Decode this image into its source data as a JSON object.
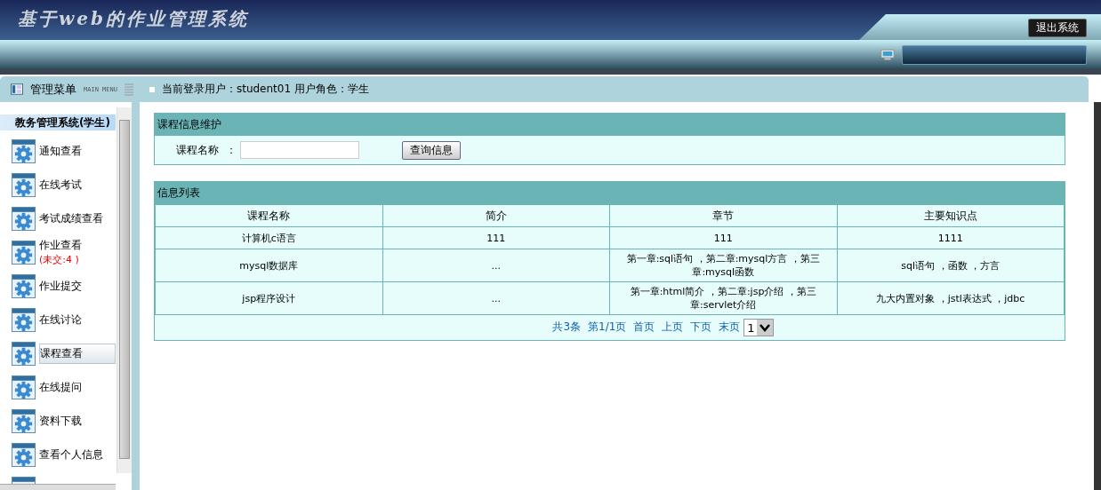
{
  "header": {
    "title": "基于web的作业管理系统",
    "logout_button": "退出系统"
  },
  "menu_bar": {
    "title": "管理菜单",
    "subtitle": "MAIN MENU",
    "user_info": "当前登录用户：student01  用户角色：学生"
  },
  "sidebar": {
    "heading": "教务管理系统(学生)",
    "items": [
      {
        "label": "通知查看",
        "selected": false
      },
      {
        "label": "在线考试",
        "selected": false
      },
      {
        "label": "考试成绩查看",
        "selected": false
      },
      {
        "label": "作业查看",
        "note": "(未交:4 )",
        "selected": false
      },
      {
        "label": "作业提交",
        "selected": false
      },
      {
        "label": "在线讨论",
        "selected": false
      },
      {
        "label": "课程查看",
        "selected": true
      },
      {
        "label": "在线提问",
        "selected": false
      },
      {
        "label": "资料下载",
        "selected": false
      },
      {
        "label": "查看个人信息",
        "selected": false
      }
    ]
  },
  "search_panel": {
    "title": "课程信息维护",
    "field_label": "课程名称",
    "separator": "：",
    "query_button": "查询信息"
  },
  "table": {
    "title": "信息列表",
    "columns": [
      "课程名称",
      "简介",
      "章节",
      "主要知识点"
    ],
    "rows": [
      [
        "计算机c语言",
        "111",
        "111",
        "1111"
      ],
      [
        "mysql数据库",
        "...",
        "第一章:sql语句 ，第二章:mysql方言 ，第三章:mysql函数",
        "sql语句 ，函数 ，方言"
      ],
      [
        "jsp程序设计",
        "...",
        "第一章:html简介 ，第二章:jsp介绍 ，第三章:servlet介绍",
        "九大内置对象 ，jstl表达式 ，jdbc"
      ]
    ]
  },
  "pager": {
    "summary": "共3条",
    "page_info": "第1/1页",
    "links": [
      "首页",
      "上页",
      "下页",
      "末页"
    ],
    "page_select": "1"
  }
}
